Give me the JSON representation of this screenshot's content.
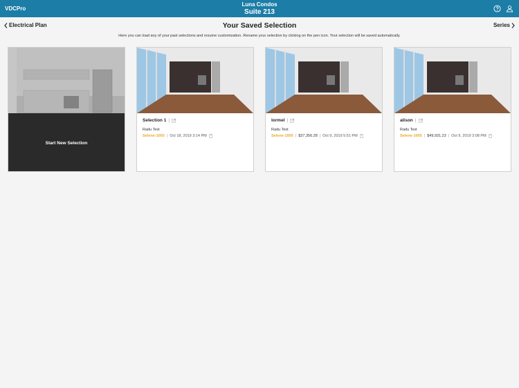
{
  "header": {
    "app_name": "VDCPro",
    "project": "Luna Condos",
    "suite": "Suite 213",
    "help_icon": "help-circle-icon",
    "user_icon": "user-icon",
    "bg_color": "#1c7da6"
  },
  "nav": {
    "back_label": "Electrical Plan",
    "next_label": "Series"
  },
  "page": {
    "title": "Your Saved Selection",
    "subtitle": "Here you can load any of your past selections and resume customization. Rename your selection by clicking on the pen icon. Your selection will be saved automatically."
  },
  "new_selection": {
    "label": "Start New Selection"
  },
  "selections": [
    {
      "name": "Selection 1",
      "user": "Radu Test",
      "series": "Selene-1005",
      "price": "",
      "date": "Oct 18, 2019 3:14 PM"
    },
    {
      "name": "lormel",
      "user": "Radu Test",
      "series": "Selene-1005",
      "price": "$37,356.28",
      "date": "Oct 9, 2019 5:51 PM"
    },
    {
      "name": "alison",
      "user": "Radu Test",
      "series": "Selene-1005",
      "price": "$49,931.23",
      "date": "Oct 9, 2019 3:08 PM"
    }
  ],
  "colors": {
    "accent": "#1c7da6",
    "series": "#e8a92a"
  }
}
